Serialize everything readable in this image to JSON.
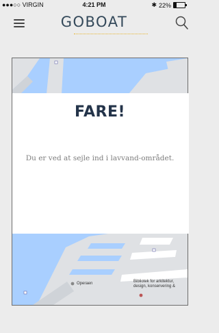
{
  "status_bar": {
    "carrier": "●●●○○ VIRGIN",
    "time": "4:21 PM",
    "battery_text": "22%",
    "battery_level": 0.22
  },
  "header": {
    "logo": "GOBOAT",
    "menu_icon": "hamburger-menu-icon",
    "search_icon": "search-icon"
  },
  "dialog": {
    "title": "FARE!",
    "message": "Du er ved at sejle ind i lavvand-området."
  },
  "map": {
    "label_opera": "Operaen",
    "label_library": "Bibliotek for arkitektur, design, konservering &"
  },
  "colors": {
    "accent_yellow": "#e7b52c",
    "logo_text": "#34495a",
    "water": "#a9cfff",
    "land": "#dfe1e4"
  }
}
